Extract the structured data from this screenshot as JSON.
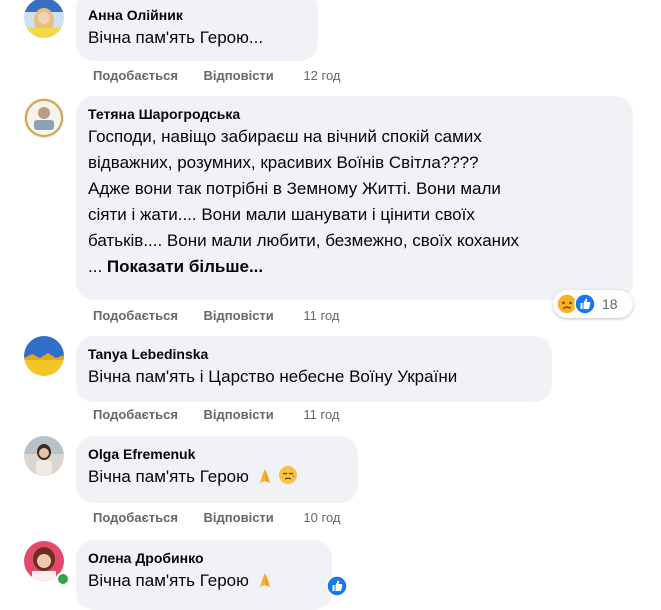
{
  "action_labels": {
    "like": "Подобається",
    "reply": "Відповісти"
  },
  "comments": [
    {
      "author": "Анна Олійник",
      "lines": [
        "Вічна пам'ять Герою..."
      ],
      "time": "12 год"
    },
    {
      "author": "Тетяна Шарогродська",
      "lines": [
        "Господи, навіщо забираєш на вічний спокій самих",
        "відважних, розумних, красивих Воїнів Світла????",
        "Адже вони так потрібні в Земному Житті. Вони мали",
        "сіяти і жати.... Вони мали шанувати і цінити своїх",
        "батьків.... Вони мали любити, безмежно, своїх коханих"
      ],
      "ellipsis": "... ",
      "see_more": "Показати більше...",
      "time": "11 год",
      "reactions": {
        "icons": [
          "sad-reaction-icon",
          "like-reaction-icon"
        ],
        "count": "18"
      }
    },
    {
      "author": "Tanya Lebedinska",
      "lines": [
        "Вічна пам'ять і Царство небесне Воїну України"
      ],
      "time": "11 год"
    },
    {
      "author": "Olga Efremenuk",
      "lines": [
        "Вічна пам'ять Герою"
      ],
      "emojis": [
        "folded-hands-icon",
        "sad-relieved-face-icon"
      ],
      "time": "10 год"
    },
    {
      "author": "Олена Дробинко",
      "lines": [
        "Вічна пам'ять Герою"
      ],
      "emojis": [
        "folded-hands-icon",
        "like-reaction-icon"
      ]
    }
  ],
  "colors": {
    "bubble": "#f0f2f5",
    "secondary_text": "#65676b",
    "like_blue": "#1877f2",
    "online": "#31a24c"
  }
}
